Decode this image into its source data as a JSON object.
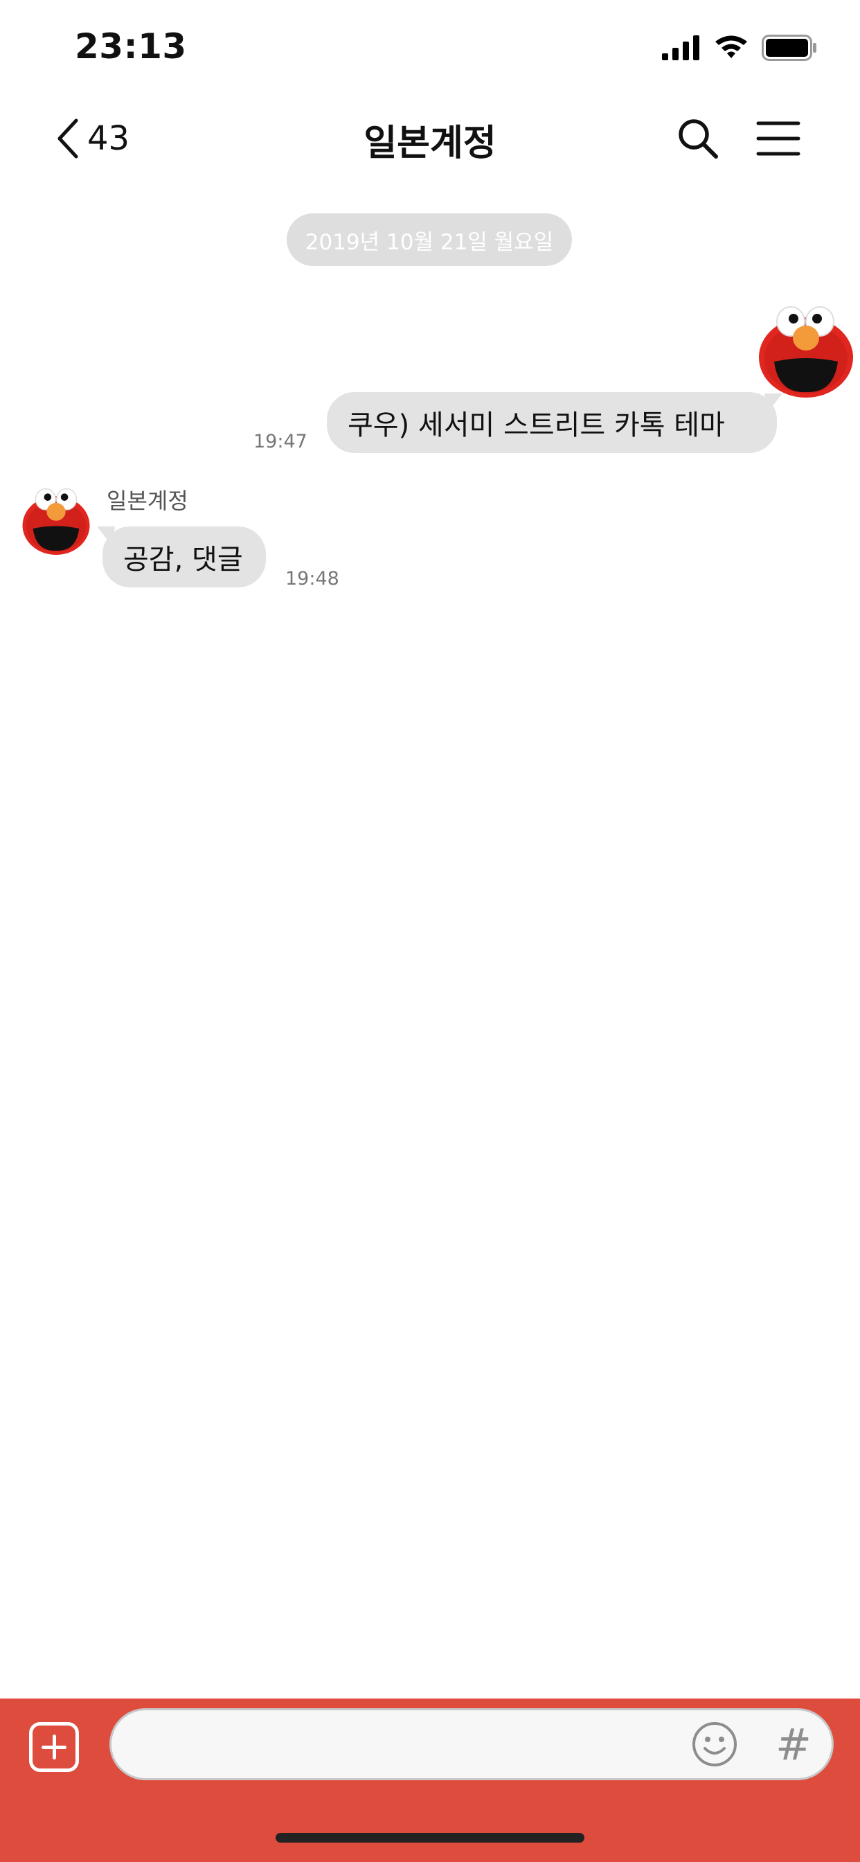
{
  "status_bar": {
    "time": "23:13"
  },
  "header": {
    "back_count": "43",
    "title": "일본계정"
  },
  "date_divider": "2019년 10월 21일 월요일",
  "messages": [
    {
      "direction": "outgoing",
      "text": "쿠우) 세서미 스트리트 카톡 테마",
      "time": "19:47"
    },
    {
      "direction": "incoming",
      "sender": "일본계정",
      "text": "공감, 댓글",
      "time": "19:48"
    }
  ],
  "input": {
    "placeholder": "",
    "hash_symbol": "#"
  },
  "colors": {
    "accent": "#dd4c3d",
    "bubble": "#e3e3e3",
    "date_pill": "#dedede"
  }
}
